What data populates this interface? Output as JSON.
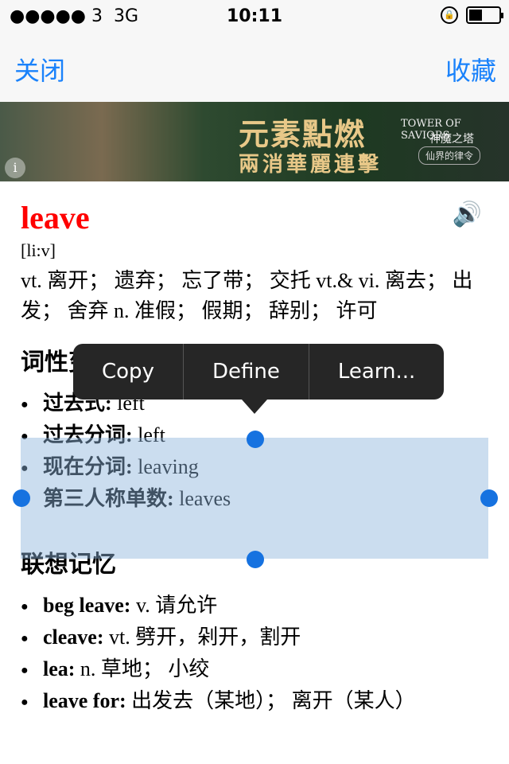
{
  "status": {
    "carrier": "●●●●● 3",
    "network": "3G",
    "time": "10:11"
  },
  "nav": {
    "close": "关闭",
    "favorite": "收藏"
  },
  "banner": {
    "title": "元素點燃",
    "subtitle": "兩消華麗連擊",
    "brand": "TOWER OF SAVIORS",
    "brand_cn": "神魔之塔",
    "tag": "仙界的律令"
  },
  "entry": {
    "word": "leave",
    "phonetic": "[li:v]",
    "definition": "vt. 离开； 遗弃； 忘了带； 交托 vt.& vi. 离去； 出发； 舍弃 n. 准假； 假期； 辞别； 许可"
  },
  "forms": {
    "heading": "词性变化",
    "items": [
      {
        "label": "过去式:",
        "value": " left"
      },
      {
        "label": "过去分词:",
        "value": " left"
      },
      {
        "label": "现在分词:",
        "value": " leaving"
      },
      {
        "label": "第三人称单数:",
        "value": " leaves"
      }
    ]
  },
  "related": {
    "heading": "联想记忆",
    "items": [
      {
        "label": "beg leave:",
        "value": " v. 请允许"
      },
      {
        "label": "cleave:",
        "value": " vt. 劈开，剁开，割开"
      },
      {
        "label": "lea:",
        "value": " n. 草地； 小绞"
      },
      {
        "label": "leave for:",
        "value": " 出发去（某地）； 离开（某人）"
      }
    ]
  },
  "menu": {
    "copy": "Copy",
    "define": "Define",
    "learn": "Learn..."
  }
}
